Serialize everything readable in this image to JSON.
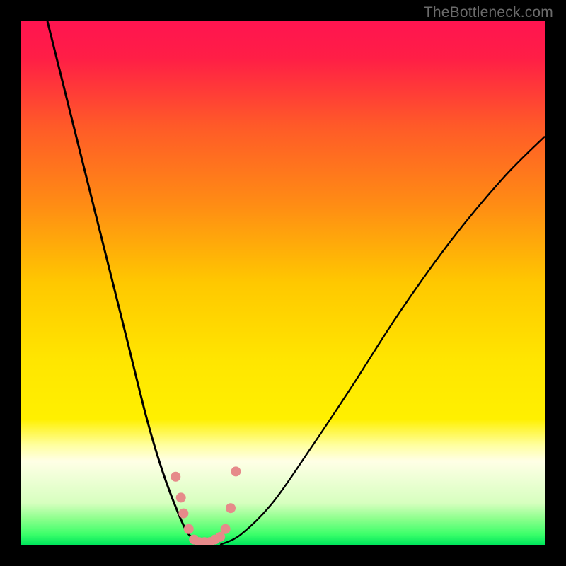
{
  "watermark": "TheBottleneck.com",
  "chart_data": {
    "type": "line",
    "title": "",
    "xlabel": "",
    "ylabel": "",
    "xlim": [
      0,
      100
    ],
    "ylim": [
      0,
      100
    ],
    "gradient": {
      "description": "vertical background gradient representing bottleneck severity",
      "stops": [
        {
          "pos": 0.0,
          "color": "#ff1450"
        },
        {
          "pos": 0.07,
          "color": "#ff1e46"
        },
        {
          "pos": 0.2,
          "color": "#ff5a28"
        },
        {
          "pos": 0.35,
          "color": "#ff8c14"
        },
        {
          "pos": 0.5,
          "color": "#ffc800"
        },
        {
          "pos": 0.65,
          "color": "#ffe600"
        },
        {
          "pos": 0.76,
          "color": "#fff000"
        },
        {
          "pos": 0.81,
          "color": "#ffffa0"
        },
        {
          "pos": 0.84,
          "color": "#ffffe6"
        },
        {
          "pos": 0.92,
          "color": "#d7ffbf"
        },
        {
          "pos": 0.95,
          "color": "#8dff8d"
        },
        {
          "pos": 0.98,
          "color": "#3cff6a"
        },
        {
          "pos": 1.0,
          "color": "#00e65c"
        }
      ]
    },
    "series": [
      {
        "name": "bottleneck-curve-left",
        "color": "#000000",
        "x": [
          5,
          8,
          12,
          16,
          20,
          24,
          27,
          30,
          32,
          34,
          35
        ],
        "y": [
          100,
          88,
          72,
          56,
          40,
          24,
          14,
          6,
          2,
          0.5,
          0
        ]
      },
      {
        "name": "bottleneck-curve-right",
        "color": "#000000",
        "x": [
          38,
          42,
          48,
          55,
          63,
          72,
          82,
          92,
          100
        ],
        "y": [
          0,
          2,
          8,
          18,
          30,
          44,
          58,
          70,
          78
        ]
      },
      {
        "name": "highlight-markers",
        "color": "#e68a8a",
        "type": "scatter",
        "marker_size": 14,
        "x": [
          29.5,
          30.5,
          31,
          32,
          33,
          34,
          35,
          36,
          37,
          38,
          39,
          40,
          41
        ],
        "y": [
          13,
          9,
          6,
          3,
          1,
          0.5,
          0.5,
          0.5,
          1,
          1.5,
          3,
          7,
          14
        ]
      }
    ]
  }
}
